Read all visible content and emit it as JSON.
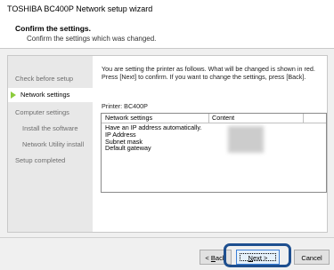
{
  "window": {
    "title": "TOSHIBA BC400P Network setup wizard"
  },
  "header": {
    "title": "Confirm the settings.",
    "subtitle": "Confirm the settings which was changed."
  },
  "sidebar": {
    "items": [
      {
        "label": "Check before setup",
        "active": false
      },
      {
        "label": "Network settings",
        "active": true
      },
      {
        "label": "Computer settings",
        "active": false
      },
      {
        "label": "Install the software",
        "active": false
      },
      {
        "label": "Network Utility install",
        "active": false
      },
      {
        "label": "Setup completed",
        "active": false
      }
    ]
  },
  "main": {
    "description_line1": "You are setting the printer as follows. What will be changed is shown in red.",
    "description_line2": "Press [Next] to confirm. If you want to change the settings, press [Back].",
    "printer_label": "Printer: BC400P",
    "table": {
      "columns": [
        "Network settings",
        "Content"
      ],
      "rows": [
        "Have an IP address automatically.",
        "IP Address",
        "Subnet mask",
        "Default gateway"
      ]
    }
  },
  "buttons": {
    "back_prefix": "< ",
    "back_key": "B",
    "back_rest": "ack",
    "next_key": "N",
    "next_rest": "ext >",
    "cancel": "Cancel"
  },
  "colors": {
    "active_arrow": "#8ccc3c",
    "highlight_ring": "#1e4f8f"
  }
}
